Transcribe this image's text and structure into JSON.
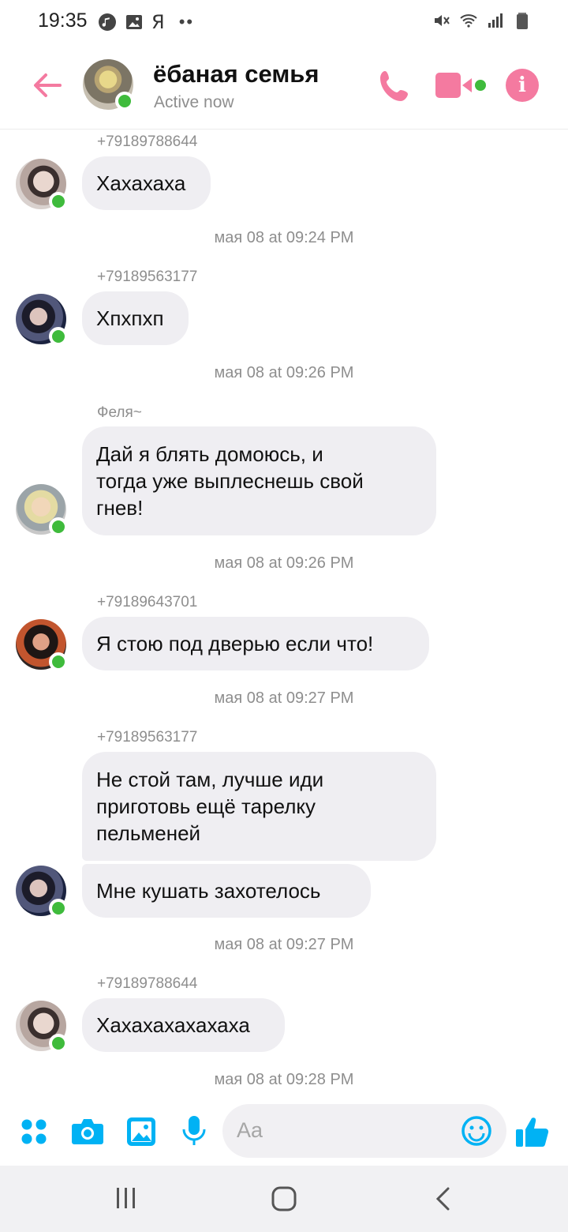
{
  "status_bar": {
    "time": "19:35",
    "carrier_glyph": "Я",
    "dots": "••"
  },
  "header": {
    "title": "ёбаная семья",
    "status": "Active now",
    "icons": [
      "back-arrow-icon",
      "phone-icon",
      "video-camera-icon",
      "info-icon"
    ],
    "info_glyph": "i",
    "accent_color": "#f47aa0",
    "online_color": "#3fbb3c"
  },
  "messages": [
    {
      "sender": "+79189788644",
      "text": "Хахахаха"
    },
    {
      "timestamp": "мая 08 at 09:24 PM"
    },
    {
      "sender": "+79189563177",
      "text": "Хпхпхп"
    },
    {
      "timestamp": "мая 08 at 09:26 PM"
    },
    {
      "sender": "Феля~",
      "text_lines": [
        "Дай я блять домоюсь, и",
        "тогда уже выплеснешь свой",
        "гнев!"
      ]
    },
    {
      "timestamp": "мая 08 at 09:26 PM"
    },
    {
      "sender": "+79189643701",
      "text": "Я стою под дверью если что!"
    },
    {
      "timestamp": "мая 08 at 09:27 PM"
    },
    {
      "sender": "+79189563177",
      "text_lines": [
        "Не стой там, лучше иди",
        "приготовь ещё тарелку",
        "пельменей"
      ],
      "text2": "Мне кушать захотелось"
    },
    {
      "timestamp": "мая 08 at 09:27 PM"
    },
    {
      "sender": "+79189788644",
      "text": "Хахахахахахаха"
    },
    {
      "timestamp": "мая 08 at 09:28 PM"
    }
  ],
  "composer": {
    "placeholder": "Aa",
    "icons": [
      "menu-dots-icon",
      "camera-icon",
      "gallery-icon",
      "microphone-icon",
      "emoji-icon",
      "thumbs-up-icon"
    ],
    "icon_color": "#00b2f4"
  },
  "navbar": {
    "icons": [
      "recent-apps-icon",
      "home-icon",
      "back-icon"
    ]
  }
}
